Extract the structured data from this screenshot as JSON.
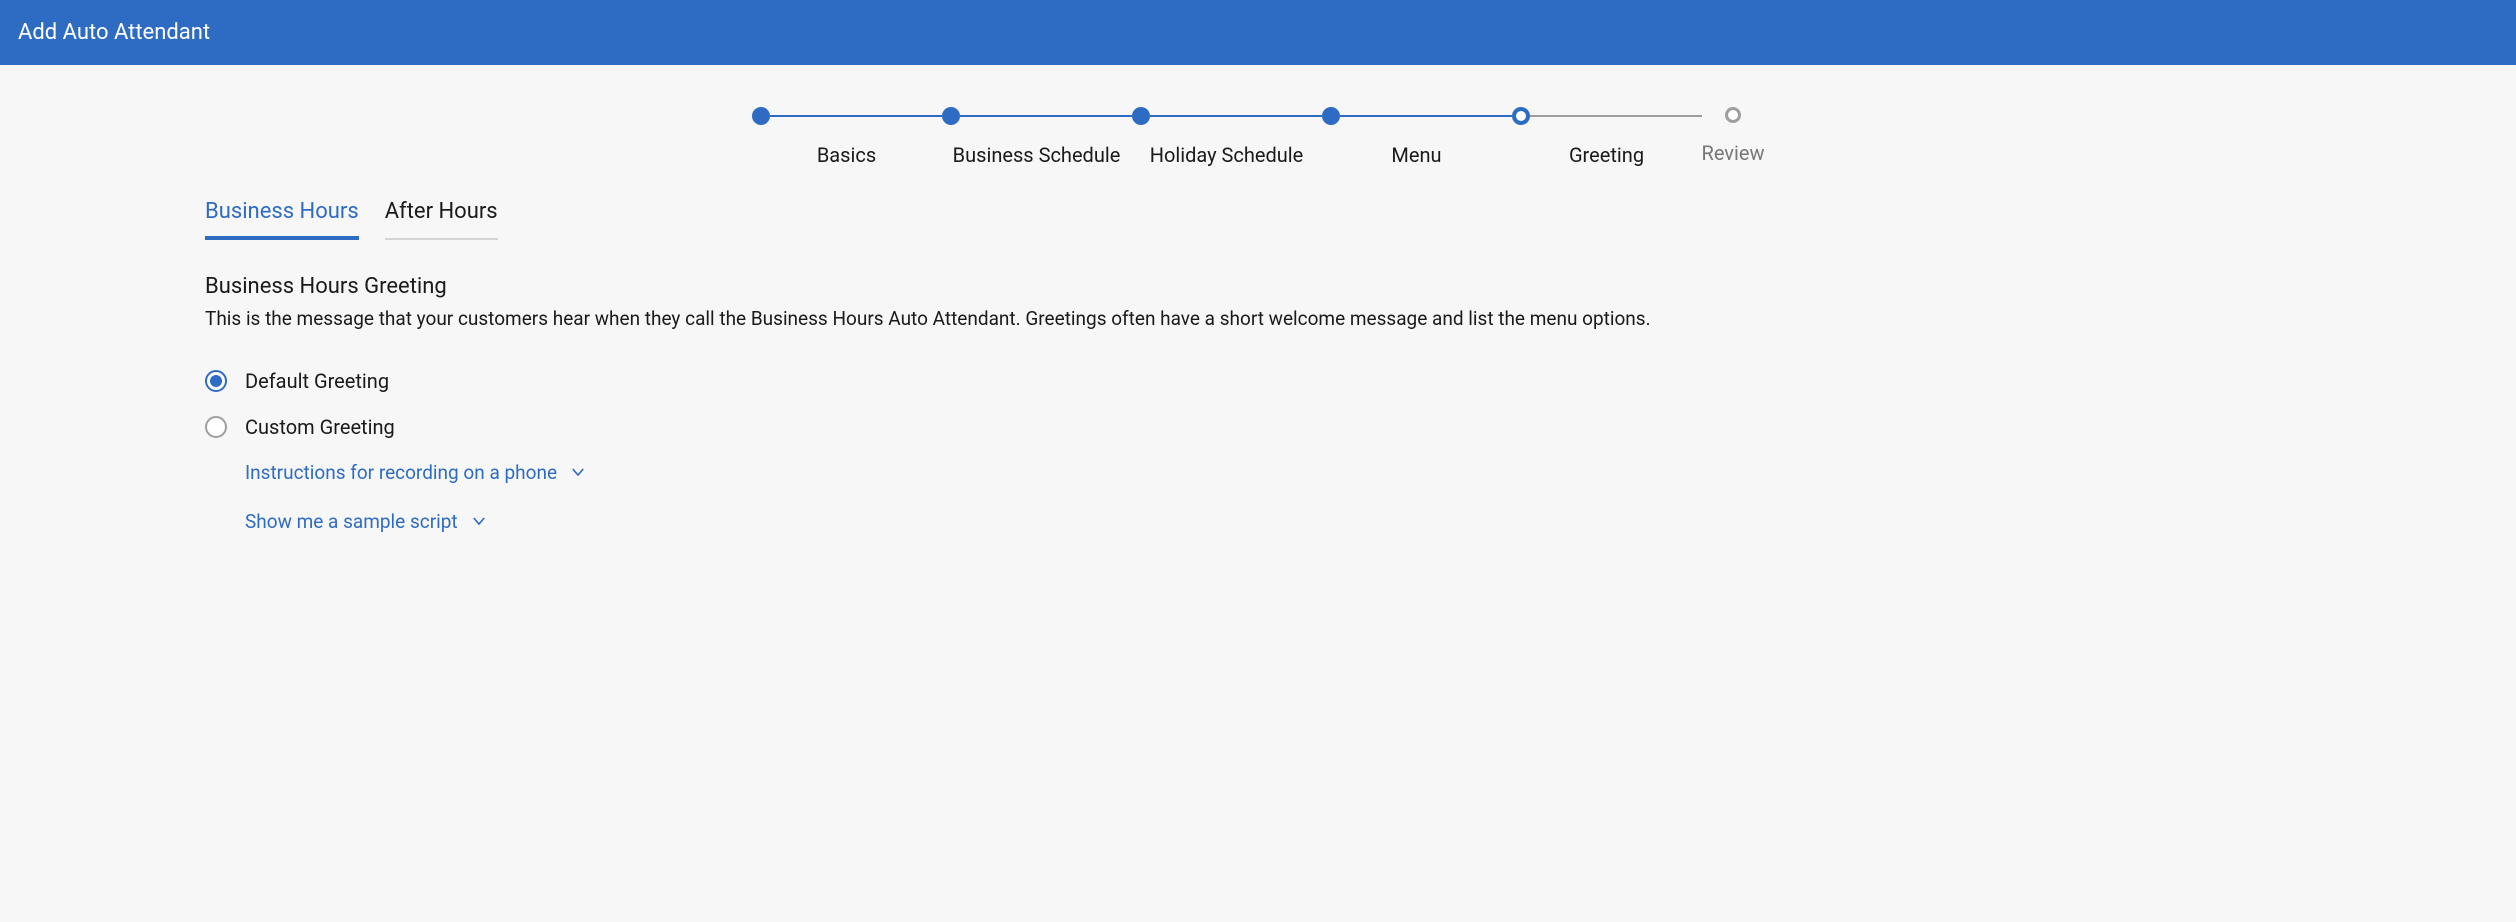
{
  "header": {
    "title": "Add Auto Attendant"
  },
  "stepper": {
    "steps": [
      {
        "label": "Basics",
        "state": "done"
      },
      {
        "label": "Business Schedule",
        "state": "done"
      },
      {
        "label": "Holiday Schedule",
        "state": "done"
      },
      {
        "label": "Menu",
        "state": "done"
      },
      {
        "label": "Greeting",
        "state": "current"
      },
      {
        "label": "Review",
        "state": "future"
      }
    ]
  },
  "tabs": [
    {
      "label": "Business Hours",
      "active": true
    },
    {
      "label": "After Hours",
      "active": false
    }
  ],
  "section": {
    "title": "Business Hours Greeting",
    "description": "This is the message that your customers hear when they call the Business Hours Auto Attendant. Greetings often have a short welcome message and list the menu options."
  },
  "greeting_options": [
    {
      "label": "Default Greeting",
      "checked": true
    },
    {
      "label": "Custom Greeting",
      "checked": false
    }
  ],
  "links": {
    "instructions": "Instructions for recording on a phone",
    "sample_script": "Show me a sample script"
  }
}
